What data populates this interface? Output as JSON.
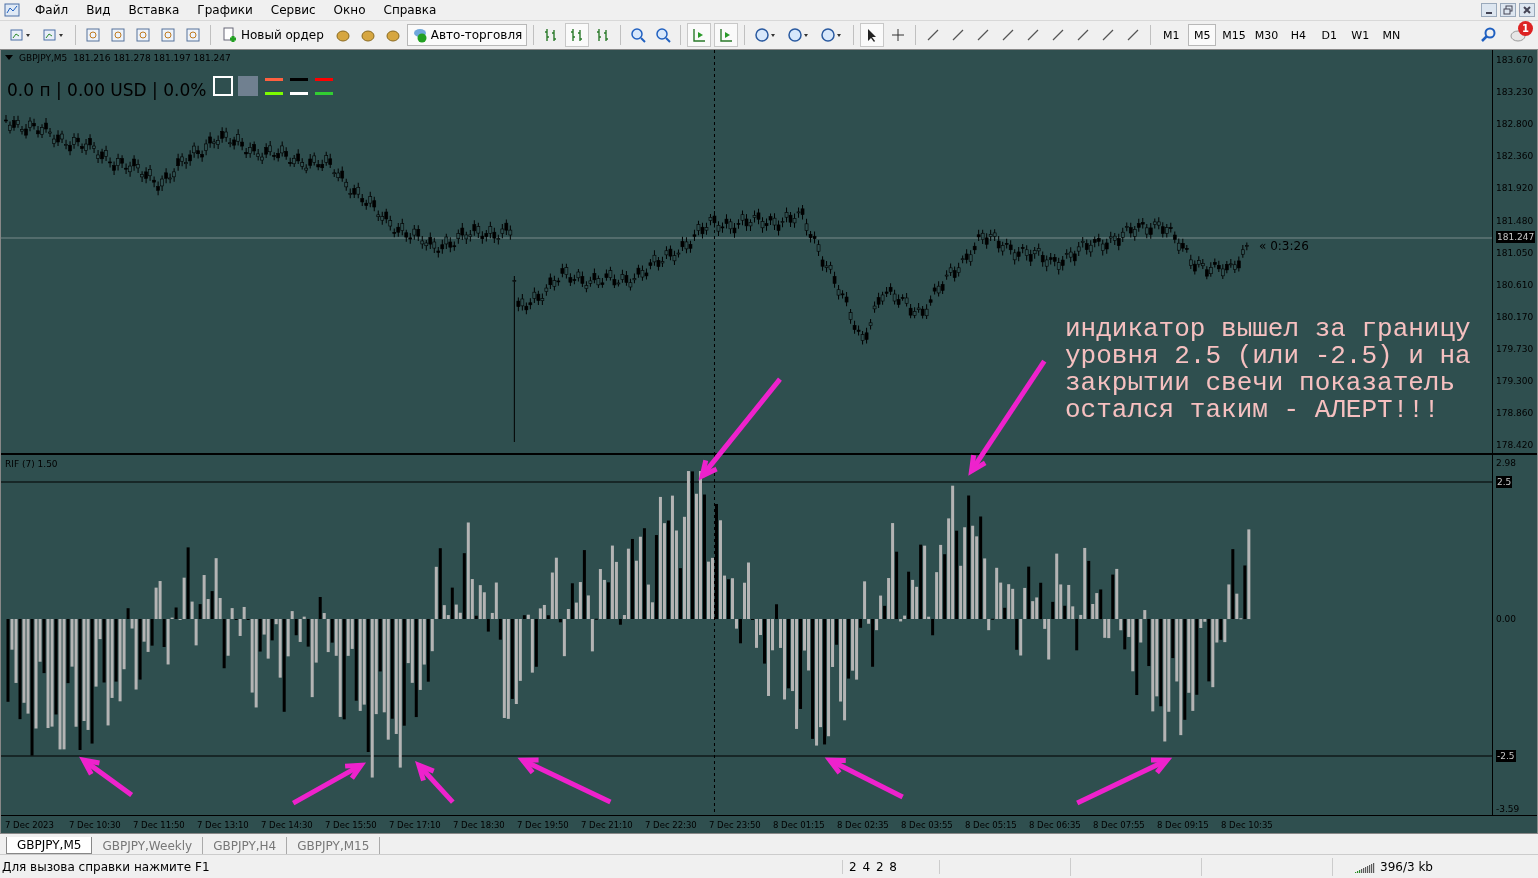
{
  "menu": [
    "Файл",
    "Вид",
    "Вставка",
    "Графики",
    "Сервис",
    "Окно",
    "Справка"
  ],
  "toolbar": {
    "new_order": "Новый ордер",
    "auto_trading": {
      "label": "Авто-торговля",
      "on": true
    },
    "timeframes": [
      {
        "label": "M1",
        "selected": false
      },
      {
        "label": "M5",
        "selected": true
      },
      {
        "label": "M15",
        "selected": false
      },
      {
        "label": "M30",
        "selected": false
      },
      {
        "label": "H4",
        "selected": false
      },
      {
        "label": "D1",
        "selected": false
      },
      {
        "label": "W1",
        "selected": false
      },
      {
        "label": "MN",
        "selected": false
      }
    ],
    "notification_count": "1"
  },
  "chart": {
    "symbol": "GBPJPY,M5",
    "ohlc": "181.216 181.278 181.197 181.247",
    "account_line": "0.0 п | 0.00 USD | 0.0%",
    "countdown": "« 0:3:26",
    "current_price": "181.247",
    "price_axis": [
      "183.670",
      "183.230",
      "182.800",
      "182.360",
      "181.920",
      "181.480",
      "181.050",
      "180.610",
      "180.170",
      "179.730",
      "179.300",
      "178.860",
      "178.420"
    ],
    "indicator": {
      "label": "RIF (7) 1.50",
      "axis": [
        {
          "label": "2.98",
          "kind": "plain"
        },
        {
          "label": "2.5",
          "kind": "level"
        },
        {
          "label": "0.00",
          "kind": "plain"
        },
        {
          "label": "-2.5",
          "kind": "level"
        },
        {
          "label": "-3.59",
          "kind": "plain"
        }
      ]
    },
    "time_axis": [
      "7 Dec 2023",
      "7 Dec 10:30",
      "7 Dec 11:50",
      "7 Dec 13:10",
      "7 Dec 14:30",
      "7 Dec 15:50",
      "7 Dec 17:10",
      "7 Dec 18:30",
      "7 Dec 19:50",
      "7 Dec 21:10",
      "7 Dec 22:30",
      "7 Dec 23:50",
      "8 Dec 01:15",
      "8 Dec 02:35",
      "8 Dec 03:55",
      "8 Dec 05:15",
      "8 Dec 06:35",
      "8 Dec 07:55",
      "8 Dec 09:15",
      "8 Dec 10:35"
    ],
    "annotation": [
      "индикатор вышел за границу",
      "уровня 2.5 (или -2.5) и на",
      "закрытии свечи показатель",
      "остался таким - АЛЕРТ!!!"
    ]
  },
  "tabs": [
    {
      "label": "GBPJPY,M5",
      "selected": true
    },
    {
      "label": "GBPJPY,Weekly",
      "selected": false
    },
    {
      "label": "GBPJPY,H4",
      "selected": false
    },
    {
      "label": "GBPJPY,M15",
      "selected": false
    }
  ],
  "status_bar": {
    "help": "Для вызова справки нажмите F1",
    "bars": "2 4 2 8",
    "traffic": "396/3 kb"
  }
}
